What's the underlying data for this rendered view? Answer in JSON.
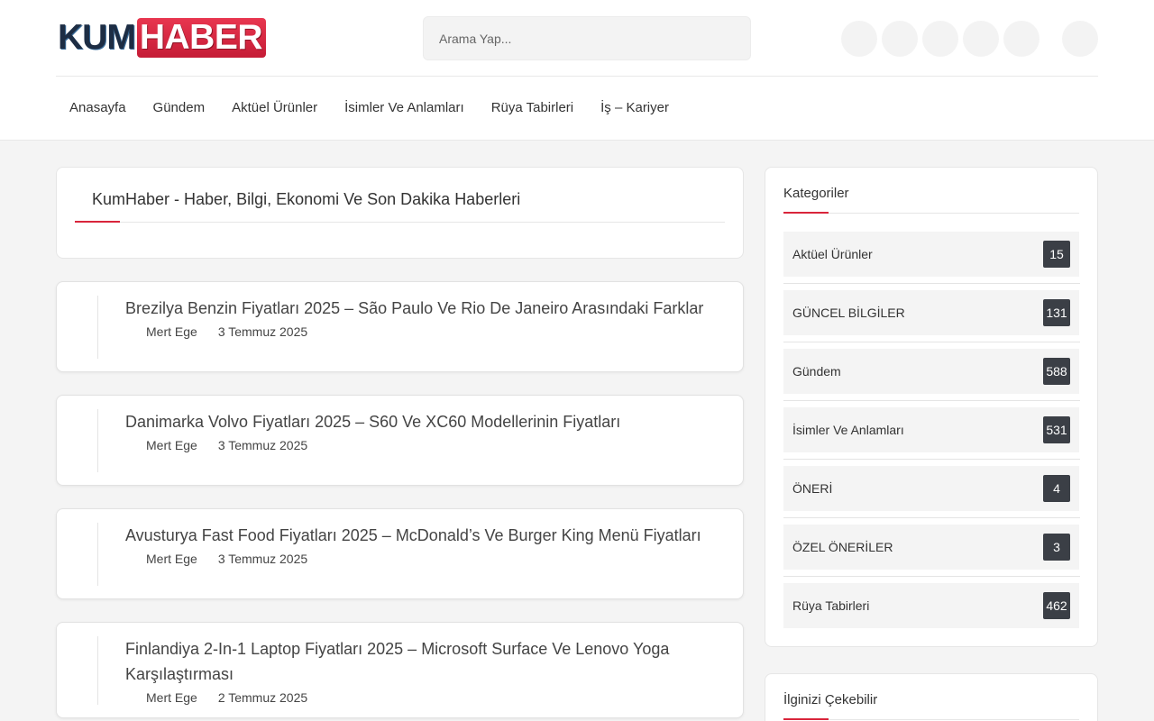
{
  "header": {
    "logo_part1": "KUM",
    "logo_part2": "HABER",
    "search_placeholder": "Arama Yap...",
    "social_icons": [
      "social-icon-1",
      "social-icon-2",
      "social-icon-3",
      "social-icon-4",
      "social-icon-5"
    ],
    "user_icon": "user-icon"
  },
  "nav": {
    "items": [
      "Anasayfa",
      "Gündem",
      "Aktüel Ürünler",
      "İsimler Ve Anlamları",
      "Rüya Tabirleri",
      "İş – Kariyer"
    ]
  },
  "page": {
    "title": "KumHaber - Haber, Bilgi, Ekonomi Ve Son Dakika Haberleri"
  },
  "posts": [
    {
      "title": "Brezilya Benzin Fiyatları 2025 – São Paulo Ve Rio De Janeiro Arasındaki Farklar",
      "author": "Mert Ege",
      "date": "3 Temmuz 2025"
    },
    {
      "title": "Danimarka Volvo Fiyatları 2025 – S60 Ve XC60 Modellerinin Fiyatları",
      "author": "Mert Ege",
      "date": "3 Temmuz 2025"
    },
    {
      "title": "Avusturya Fast Food Fiyatları 2025 – McDonald’s Ve Burger King Menü Fiyatları",
      "author": "Mert Ege",
      "date": "3 Temmuz 2025"
    },
    {
      "title": "Finlandiya 2-In-1 Laptop Fiyatları 2025 – Microsoft Surface Ve Lenovo Yoga Karşılaştırması",
      "author": "Mert Ege",
      "date": "2 Temmuz 2025"
    }
  ],
  "sidebar": {
    "categories_title": "Kategoriler",
    "categories": [
      {
        "name": "Aktüel Ürünler",
        "count": "15"
      },
      {
        "name": "GÜNCEL BİLGİLER",
        "count": "131"
      },
      {
        "name": "Gündem",
        "count": "588"
      },
      {
        "name": "İsimler Ve Anlamları",
        "count": "531"
      },
      {
        "name": "ÖNERİ",
        "count": "4"
      },
      {
        "name": "ÖZEL ÖNERİLER",
        "count": "3"
      },
      {
        "name": "Rüya Tabirleri",
        "count": "462"
      }
    ],
    "related_title": "İlginizi Çekebilir"
  },
  "colors": {
    "accent": "#d9253b",
    "badge_bg": "#3b3f46",
    "logo_dark": "#1d2d44"
  }
}
